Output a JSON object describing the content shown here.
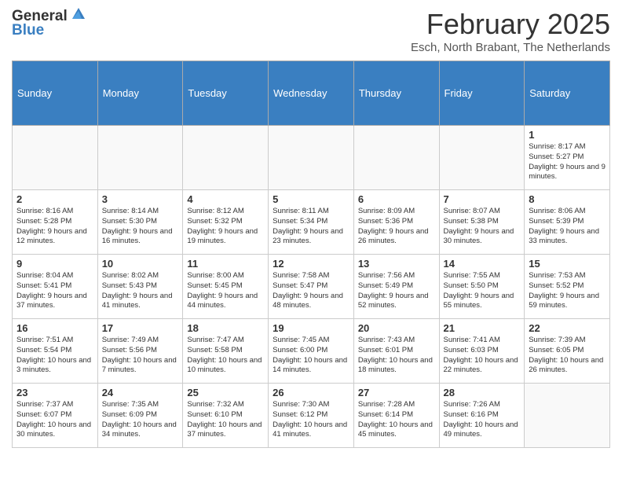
{
  "header": {
    "logo_line1": "General",
    "logo_line2": "Blue",
    "month": "February 2025",
    "location": "Esch, North Brabant, The Netherlands"
  },
  "days_of_week": [
    "Sunday",
    "Monday",
    "Tuesday",
    "Wednesday",
    "Thursday",
    "Friday",
    "Saturday"
  ],
  "weeks": [
    [
      {
        "day": "",
        "info": ""
      },
      {
        "day": "",
        "info": ""
      },
      {
        "day": "",
        "info": ""
      },
      {
        "day": "",
        "info": ""
      },
      {
        "day": "",
        "info": ""
      },
      {
        "day": "",
        "info": ""
      },
      {
        "day": "1",
        "info": "Sunrise: 8:17 AM\nSunset: 5:27 PM\nDaylight: 9 hours and 9 minutes."
      }
    ],
    [
      {
        "day": "2",
        "info": "Sunrise: 8:16 AM\nSunset: 5:28 PM\nDaylight: 9 hours and 12 minutes."
      },
      {
        "day": "3",
        "info": "Sunrise: 8:14 AM\nSunset: 5:30 PM\nDaylight: 9 hours and 16 minutes."
      },
      {
        "day": "4",
        "info": "Sunrise: 8:12 AM\nSunset: 5:32 PM\nDaylight: 9 hours and 19 minutes."
      },
      {
        "day": "5",
        "info": "Sunrise: 8:11 AM\nSunset: 5:34 PM\nDaylight: 9 hours and 23 minutes."
      },
      {
        "day": "6",
        "info": "Sunrise: 8:09 AM\nSunset: 5:36 PM\nDaylight: 9 hours and 26 minutes."
      },
      {
        "day": "7",
        "info": "Sunrise: 8:07 AM\nSunset: 5:38 PM\nDaylight: 9 hours and 30 minutes."
      },
      {
        "day": "8",
        "info": "Sunrise: 8:06 AM\nSunset: 5:39 PM\nDaylight: 9 hours and 33 minutes."
      }
    ],
    [
      {
        "day": "9",
        "info": "Sunrise: 8:04 AM\nSunset: 5:41 PM\nDaylight: 9 hours and 37 minutes."
      },
      {
        "day": "10",
        "info": "Sunrise: 8:02 AM\nSunset: 5:43 PM\nDaylight: 9 hours and 41 minutes."
      },
      {
        "day": "11",
        "info": "Sunrise: 8:00 AM\nSunset: 5:45 PM\nDaylight: 9 hours and 44 minutes."
      },
      {
        "day": "12",
        "info": "Sunrise: 7:58 AM\nSunset: 5:47 PM\nDaylight: 9 hours and 48 minutes."
      },
      {
        "day": "13",
        "info": "Sunrise: 7:56 AM\nSunset: 5:49 PM\nDaylight: 9 hours and 52 minutes."
      },
      {
        "day": "14",
        "info": "Sunrise: 7:55 AM\nSunset: 5:50 PM\nDaylight: 9 hours and 55 minutes."
      },
      {
        "day": "15",
        "info": "Sunrise: 7:53 AM\nSunset: 5:52 PM\nDaylight: 9 hours and 59 minutes."
      }
    ],
    [
      {
        "day": "16",
        "info": "Sunrise: 7:51 AM\nSunset: 5:54 PM\nDaylight: 10 hours and 3 minutes."
      },
      {
        "day": "17",
        "info": "Sunrise: 7:49 AM\nSunset: 5:56 PM\nDaylight: 10 hours and 7 minutes."
      },
      {
        "day": "18",
        "info": "Sunrise: 7:47 AM\nSunset: 5:58 PM\nDaylight: 10 hours and 10 minutes."
      },
      {
        "day": "19",
        "info": "Sunrise: 7:45 AM\nSunset: 6:00 PM\nDaylight: 10 hours and 14 minutes."
      },
      {
        "day": "20",
        "info": "Sunrise: 7:43 AM\nSunset: 6:01 PM\nDaylight: 10 hours and 18 minutes."
      },
      {
        "day": "21",
        "info": "Sunrise: 7:41 AM\nSunset: 6:03 PM\nDaylight: 10 hours and 22 minutes."
      },
      {
        "day": "22",
        "info": "Sunrise: 7:39 AM\nSunset: 6:05 PM\nDaylight: 10 hours and 26 minutes."
      }
    ],
    [
      {
        "day": "23",
        "info": "Sunrise: 7:37 AM\nSunset: 6:07 PM\nDaylight: 10 hours and 30 minutes."
      },
      {
        "day": "24",
        "info": "Sunrise: 7:35 AM\nSunset: 6:09 PM\nDaylight: 10 hours and 34 minutes."
      },
      {
        "day": "25",
        "info": "Sunrise: 7:32 AM\nSunset: 6:10 PM\nDaylight: 10 hours and 37 minutes."
      },
      {
        "day": "26",
        "info": "Sunrise: 7:30 AM\nSunset: 6:12 PM\nDaylight: 10 hours and 41 minutes."
      },
      {
        "day": "27",
        "info": "Sunrise: 7:28 AM\nSunset: 6:14 PM\nDaylight: 10 hours and 45 minutes."
      },
      {
        "day": "28",
        "info": "Sunrise: 7:26 AM\nSunset: 6:16 PM\nDaylight: 10 hours and 49 minutes."
      },
      {
        "day": "",
        "info": ""
      }
    ]
  ]
}
